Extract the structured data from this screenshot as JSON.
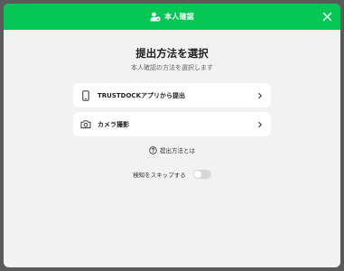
{
  "header": {
    "title": "本人確認",
    "icon": "user-check-icon",
    "close_icon": "close-icon",
    "color": "#06c755"
  },
  "main": {
    "title": "提出方法を選択",
    "subtitle": "本人確認の方法を選択します",
    "options": [
      {
        "label": "TRUSTDOCKアプリから提出",
        "icon": "smartphone-icon"
      },
      {
        "label": "カメラ撮影",
        "icon": "camera-icon"
      }
    ],
    "help_link": "提出方法とは",
    "skip_label": "検知をスキップする",
    "skip_enabled": false
  }
}
